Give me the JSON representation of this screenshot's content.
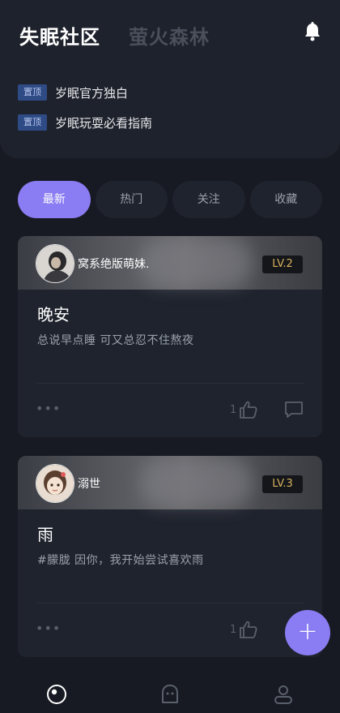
{
  "header": {
    "title_active": "失眠社区",
    "title_inactive": "萤火森林",
    "bell_icon": "bell-icon"
  },
  "pinned": [
    {
      "badge": "置顶",
      "text": "岁眠官方独白"
    },
    {
      "badge": "置顶",
      "text": "岁眠玩耍必看指南"
    }
  ],
  "tabs": [
    {
      "label": "最新",
      "active": true
    },
    {
      "label": "热门",
      "active": false
    },
    {
      "label": "关注",
      "active": false
    },
    {
      "label": "收藏",
      "active": false
    }
  ],
  "posts": [
    {
      "username": "窝系绝版萌妹.",
      "level": "LV.2",
      "title": "晚安",
      "body": "总说早点睡 可又总忍不住熬夜",
      "likes": "1",
      "more": "•••"
    },
    {
      "username": "溺世",
      "level": "LV.3",
      "title": "雨",
      "body": "#朦胧  因你，我开始尝试喜欢雨",
      "likes": "1",
      "more": "•••"
    }
  ],
  "fab": {
    "label": "+"
  },
  "nav": [
    "planet-icon",
    "ghost-icon",
    "profile-icon"
  ],
  "colors": {
    "accent": "#8a7cf2",
    "background": "#171a22",
    "card": "#1f232d",
    "pin_badge": "#2f4b86",
    "level_text": "#d6b25e"
  }
}
